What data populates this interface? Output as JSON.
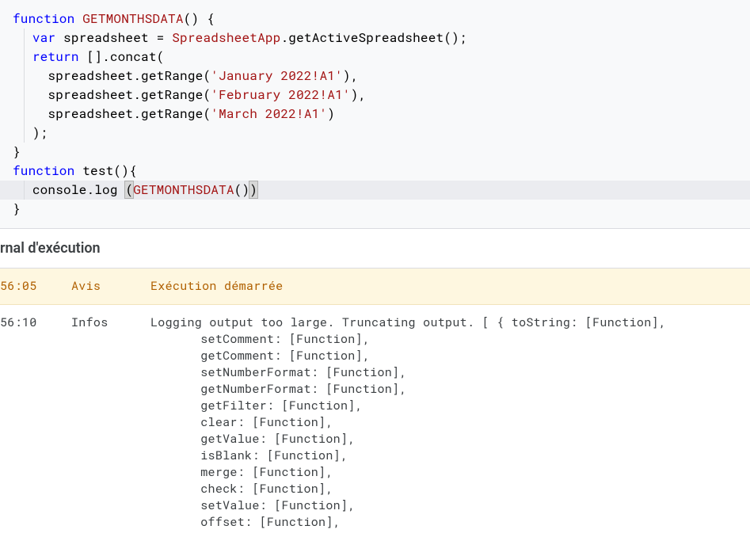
{
  "editor": {
    "lines": [
      {
        "tokens": [
          {
            "t": "function ",
            "c": "kw"
          },
          {
            "t": "GETMONTHSDATA",
            "c": "fn-name"
          },
          {
            "t": "() {",
            "c": "normal"
          }
        ],
        "indent": 0
      },
      {
        "tokens": [
          {
            "t": "var",
            "c": "kw"
          },
          {
            "t": " spreadsheet = ",
            "c": "normal"
          },
          {
            "t": "SpreadsheetApp",
            "c": "type-name"
          },
          {
            "t": ".getActiveSpreadsheet();",
            "c": "normal"
          }
        ],
        "indent": 1,
        "guide": true
      },
      {
        "tokens": [
          {
            "t": "return",
            "c": "kw"
          },
          {
            "t": " [].concat(",
            "c": "normal"
          }
        ],
        "indent": 1,
        "guide": true
      },
      {
        "tokens": [
          {
            "t": "spreadsheet.getRange(",
            "c": "normal"
          },
          {
            "t": "'January 2022!A1'",
            "c": "str"
          },
          {
            "t": "),",
            "c": "normal"
          }
        ],
        "indent": 2,
        "guide": true
      },
      {
        "tokens": [
          {
            "t": "spreadsheet.getRange(",
            "c": "normal"
          },
          {
            "t": "'February 2022!A1'",
            "c": "str"
          },
          {
            "t": "),",
            "c": "normal"
          }
        ],
        "indent": 2,
        "guide": true
      },
      {
        "tokens": [
          {
            "t": "spreadsheet.getRange(",
            "c": "normal"
          },
          {
            "t": "'March 2022!A1'",
            "c": "str"
          },
          {
            "t": ")",
            "c": "normal"
          }
        ],
        "indent": 2,
        "guide": true
      },
      {
        "tokens": [
          {
            "t": ");",
            "c": "normal"
          }
        ],
        "indent": 1,
        "guide": true
      },
      {
        "tokens": [
          {
            "t": "}",
            "c": "normal"
          }
        ],
        "indent": 0
      },
      {
        "tokens": [
          {
            "t": "function ",
            "c": "kw"
          },
          {
            "t": "test(){",
            "c": "normal"
          }
        ],
        "indent": 0
      },
      {
        "tokens": [
          {
            "t": "console.log ",
            "c": "normal"
          },
          {
            "t": "(",
            "c": "normal",
            "bm": true
          },
          {
            "t": "GETMONTHSDATA",
            "c": "fn-name"
          },
          {
            "t": "()",
            "c": "normal"
          },
          {
            "t": ")",
            "c": "normal",
            "bm": true
          }
        ],
        "indent": 1,
        "guide": true,
        "cursor": true
      },
      {
        "tokens": [
          {
            "t": "}",
            "c": "normal"
          }
        ],
        "indent": 0
      }
    ]
  },
  "log": {
    "title": "rnal d'exécution",
    "rows": [
      {
        "cls": "notice",
        "time": "56:05",
        "level": "Avis",
        "msg": "Exécution démarrée"
      },
      {
        "cls": "info",
        "time": "56:10",
        "level": "Infos",
        "msg": "Logging output too large. Truncating output. [ { toString: [Function],",
        "more": [
          "setComment: [Function],",
          "getComment: [Function],",
          "setNumberFormat: [Function],",
          "getNumberFormat: [Function],",
          "getFilter: [Function],",
          "clear: [Function],",
          "getValue: [Function],",
          "isBlank: [Function],",
          "merge: [Function],",
          "check: [Function],",
          "setValue: [Function],",
          "offset: [Function],"
        ]
      }
    ]
  }
}
